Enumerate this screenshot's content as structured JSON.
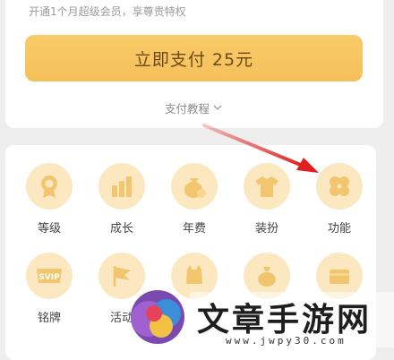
{
  "pay_card": {
    "subtitle": "开通1个月超级会员，享尊贵特权",
    "pay_button_label": "立即支付 25元",
    "tutorial_label": "支付教程"
  },
  "privileges": {
    "row1": [
      {
        "label": "等级",
        "icon": "level-badge-icon"
      },
      {
        "label": "成长",
        "icon": "growth-bars-icon"
      },
      {
        "label": "年费",
        "icon": "annual-fee-bag-icon"
      },
      {
        "label": "装扮",
        "icon": "outfit-shirt-icon"
      },
      {
        "label": "功能",
        "icon": "function-clover-icon"
      }
    ],
    "row2": [
      {
        "label": "铭牌",
        "icon": "svip-nameplate-icon"
      },
      {
        "label": "活动",
        "icon": "activity-flag-icon"
      },
      {
        "label": "",
        "icon": "cat-icon"
      },
      {
        "label": "",
        "icon": "bag-icon"
      },
      {
        "label": "",
        "icon": "card-icon"
      }
    ],
    "svip_text": "SVIP"
  },
  "watermark": {
    "title": "文章手游网",
    "url": "www.jwpy30.com",
    "logo_letter": "we"
  },
  "colors": {
    "accent_button": "#f6c35e",
    "icon_circle": "#fbe8c1",
    "icon_glyph": "#f1c66f",
    "arrow": "#e02020"
  }
}
